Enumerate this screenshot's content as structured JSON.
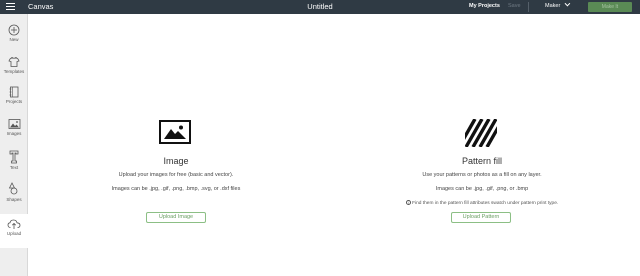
{
  "topbar": {
    "app_title": "Canvas",
    "doc_title": "Untitled",
    "my_projects": "My Projects",
    "save": "Save",
    "machine": "Maker",
    "make_it": "Make It"
  },
  "sidebar": {
    "items": [
      {
        "label": "New",
        "icon": "plus-circle-icon"
      },
      {
        "label": "Templates",
        "icon": "shirt-icon"
      },
      {
        "label": "Projects",
        "icon": "notebook-icon"
      },
      {
        "label": "Images",
        "icon": "image-icon"
      },
      {
        "label": "Text",
        "icon": "text-icon"
      },
      {
        "label": "Shapes",
        "icon": "shapes-icon"
      },
      {
        "label": "Upload",
        "icon": "upload-cloud-icon"
      }
    ]
  },
  "image_panel": {
    "title": "Image",
    "description": "Upload your images for free (basic and vector).",
    "formats": "Images can be .jpg, .gif, .png, .bmp, .svg, or .dxf files",
    "button": "Upload Image"
  },
  "pattern_panel": {
    "title": "Pattern fill",
    "description": "Use your patterns or photos as a fill on any layer.",
    "formats": "Images can be .jpg, .gif, .png, or .bmp",
    "note": "Find them in the pattern fill attributes swatch under pattern print type.",
    "button": "Upload Pattern"
  },
  "colors": {
    "topbar": "#2f3a44",
    "sidebar": "#eeeeee",
    "accent_green": "#6a9f63",
    "make_button": "#5a8a55"
  }
}
